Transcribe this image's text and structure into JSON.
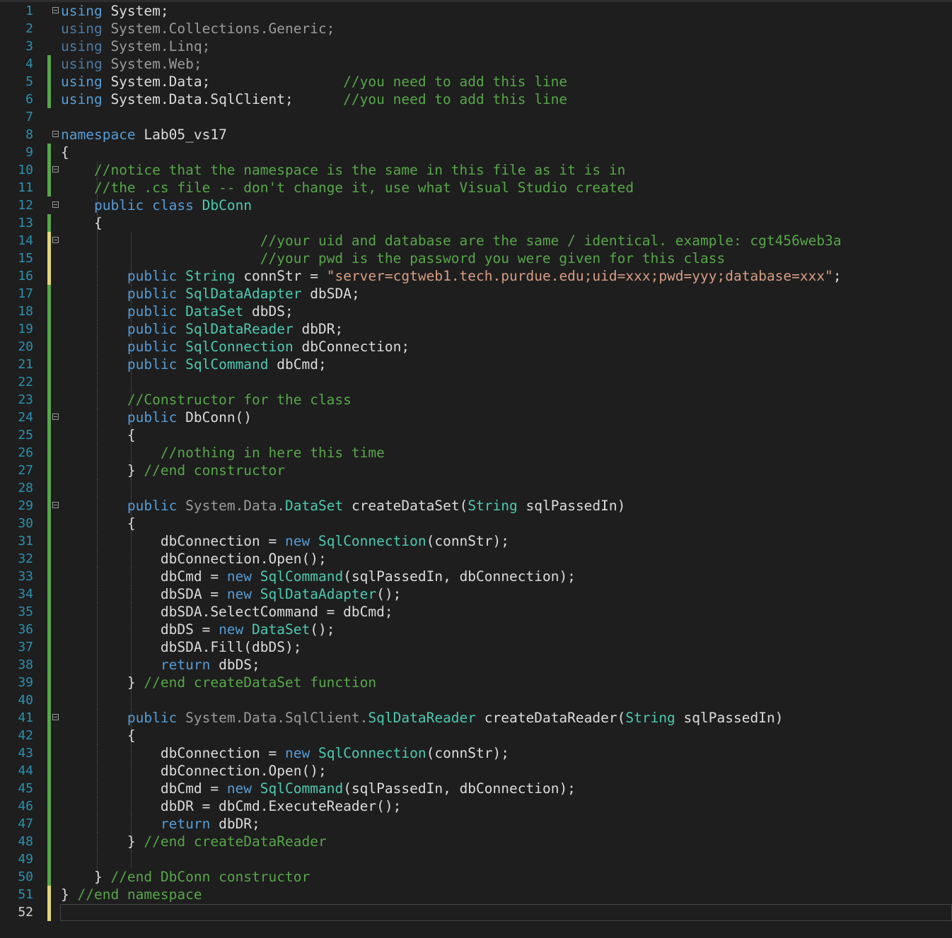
{
  "lines": [
    {
      "n": "1",
      "bar": "none",
      "fold": true,
      "segs": [
        [
          "kw",
          "using"
        ],
        [
          "txt",
          " System;"
        ]
      ]
    },
    {
      "n": "2",
      "bar": "none",
      "fold": false,
      "segs": [
        [
          "dimkw",
          "using"
        ],
        [
          "dim",
          " System.Collections.Generic;"
        ]
      ]
    },
    {
      "n": "3",
      "bar": "none",
      "fold": false,
      "segs": [
        [
          "dimkw",
          "using"
        ],
        [
          "dim",
          " System.Linq;"
        ]
      ]
    },
    {
      "n": "4",
      "bar": "green",
      "fold": false,
      "segs": [
        [
          "dimkw",
          "using"
        ],
        [
          "dim",
          " System.Web;"
        ]
      ]
    },
    {
      "n": "5",
      "bar": "green",
      "fold": false,
      "segs": [
        [
          "kw",
          "using"
        ],
        [
          "txt",
          " System.Data;                "
        ],
        [
          "cmt",
          "//you need to add this line"
        ]
      ]
    },
    {
      "n": "6",
      "bar": "green",
      "fold": false,
      "segs": [
        [
          "kw",
          "using"
        ],
        [
          "txt",
          " System.Data.SqlClient;      "
        ],
        [
          "cmt",
          "//you need to add this line"
        ]
      ]
    },
    {
      "n": "7",
      "bar": "none",
      "fold": false,
      "segs": []
    },
    {
      "n": "8",
      "bar": "none",
      "fold": true,
      "segs": [
        [
          "kw",
          "namespace"
        ],
        [
          "txt",
          " Lab05_vs17"
        ]
      ]
    },
    {
      "n": "9",
      "bar": "green",
      "fold": false,
      "segs": [
        [
          "txt",
          "{"
        ]
      ]
    },
    {
      "n": "10",
      "bar": "green",
      "fold": true,
      "segs": [
        [
          "txt",
          "    "
        ],
        [
          "cmt",
          "//notice that the namespace is the same in this file as it is in"
        ]
      ]
    },
    {
      "n": "11",
      "bar": "green",
      "fold": false,
      "segs": [
        [
          "txt",
          "    "
        ],
        [
          "cmt",
          "//the .cs file -- don't change it, use what Visual Studio created"
        ]
      ]
    },
    {
      "n": "12",
      "bar": "none",
      "fold": true,
      "segs": [
        [
          "txt",
          "    "
        ],
        [
          "kw",
          "public"
        ],
        [
          "txt",
          " "
        ],
        [
          "kw",
          "class"
        ],
        [
          "txt",
          " "
        ],
        [
          "type",
          "DbConn"
        ]
      ]
    },
    {
      "n": "13",
      "bar": "green",
      "fold": false,
      "segs": [
        [
          "txt",
          "    {"
        ]
      ]
    },
    {
      "n": "14",
      "bar": "yellow",
      "fold": true,
      "segs": [
        [
          "txt",
          "                        "
        ],
        [
          "cmt",
          "//your uid and database are the same / identical. example: cgt456web3a"
        ]
      ]
    },
    {
      "n": "15",
      "bar": "yellow",
      "fold": false,
      "segs": [
        [
          "txt",
          "                        "
        ],
        [
          "cmt",
          "//your pwd is the password you were given for this class"
        ]
      ]
    },
    {
      "n": "16",
      "bar": "yellow",
      "fold": false,
      "segs": [
        [
          "txt",
          "        "
        ],
        [
          "kw",
          "public"
        ],
        [
          "txt",
          " "
        ],
        [
          "type",
          "String"
        ],
        [
          "txt",
          " connStr = "
        ],
        [
          "str",
          "\"server=cgtweb1.tech.purdue.edu;uid=xxx;pwd=yyy;database=xxx\""
        ],
        [
          "txt",
          ";"
        ]
      ]
    },
    {
      "n": "17",
      "bar": "green",
      "fold": false,
      "segs": [
        [
          "txt",
          "        "
        ],
        [
          "kw",
          "public"
        ],
        [
          "txt",
          " "
        ],
        [
          "type",
          "SqlDataAdapter"
        ],
        [
          "txt",
          " dbSDA;"
        ]
      ]
    },
    {
      "n": "18",
      "bar": "green",
      "fold": false,
      "segs": [
        [
          "txt",
          "        "
        ],
        [
          "kw",
          "public"
        ],
        [
          "txt",
          " "
        ],
        [
          "type",
          "DataSet"
        ],
        [
          "txt",
          " dbDS;"
        ]
      ]
    },
    {
      "n": "19",
      "bar": "green",
      "fold": false,
      "segs": [
        [
          "txt",
          "        "
        ],
        [
          "kw",
          "public"
        ],
        [
          "txt",
          " "
        ],
        [
          "type",
          "SqlDataReader"
        ],
        [
          "txt",
          " dbDR;"
        ]
      ]
    },
    {
      "n": "20",
      "bar": "green",
      "fold": false,
      "segs": [
        [
          "txt",
          "        "
        ],
        [
          "kw",
          "public"
        ],
        [
          "txt",
          " "
        ],
        [
          "type",
          "SqlConnection"
        ],
        [
          "txt",
          " dbConnection;"
        ]
      ]
    },
    {
      "n": "21",
      "bar": "green",
      "fold": false,
      "segs": [
        [
          "txt",
          "        "
        ],
        [
          "kw",
          "public"
        ],
        [
          "txt",
          " "
        ],
        [
          "type",
          "SqlCommand"
        ],
        [
          "txt",
          " dbCmd;"
        ]
      ]
    },
    {
      "n": "22",
      "bar": "green",
      "fold": false,
      "segs": []
    },
    {
      "n": "23",
      "bar": "green",
      "fold": false,
      "segs": [
        [
          "txt",
          "        "
        ],
        [
          "cmt",
          "//Constructor for the class"
        ]
      ]
    },
    {
      "n": "24",
      "bar": "green",
      "fold": true,
      "segs": [
        [
          "txt",
          "        "
        ],
        [
          "kw",
          "public"
        ],
        [
          "txt",
          " DbConn()"
        ]
      ]
    },
    {
      "n": "25",
      "bar": "green",
      "fold": false,
      "segs": [
        [
          "txt",
          "        {"
        ]
      ]
    },
    {
      "n": "26",
      "bar": "green",
      "fold": false,
      "segs": [
        [
          "txt",
          "            "
        ],
        [
          "cmt",
          "//nothing in here this time"
        ]
      ]
    },
    {
      "n": "27",
      "bar": "green",
      "fold": false,
      "segs": [
        [
          "txt",
          "        } "
        ],
        [
          "cmt",
          "//end constructor"
        ]
      ]
    },
    {
      "n": "28",
      "bar": "green",
      "fold": false,
      "segs": []
    },
    {
      "n": "29",
      "bar": "green",
      "fold": true,
      "segs": [
        [
          "txt",
          "        "
        ],
        [
          "kw",
          "public"
        ],
        [
          "txt",
          " "
        ],
        [
          "dim",
          "System.Data."
        ],
        [
          "type",
          "DataSet"
        ],
        [
          "txt",
          " createDataSet("
        ],
        [
          "type",
          "String"
        ],
        [
          "txt",
          " sqlPassedIn)"
        ]
      ]
    },
    {
      "n": "30",
      "bar": "green",
      "fold": false,
      "segs": [
        [
          "txt",
          "        {"
        ]
      ]
    },
    {
      "n": "31",
      "bar": "green",
      "fold": false,
      "segs": [
        [
          "txt",
          "            dbConnection = "
        ],
        [
          "kw",
          "new"
        ],
        [
          "txt",
          " "
        ],
        [
          "type",
          "SqlConnection"
        ],
        [
          "txt",
          "(connStr);"
        ]
      ]
    },
    {
      "n": "32",
      "bar": "green",
      "fold": false,
      "segs": [
        [
          "txt",
          "            dbConnection.Open();"
        ]
      ]
    },
    {
      "n": "33",
      "bar": "green",
      "fold": false,
      "segs": [
        [
          "txt",
          "            dbCmd = "
        ],
        [
          "kw",
          "new"
        ],
        [
          "txt",
          " "
        ],
        [
          "type",
          "SqlCommand"
        ],
        [
          "txt",
          "(sqlPassedIn, dbConnection);"
        ]
      ]
    },
    {
      "n": "34",
      "bar": "green",
      "fold": false,
      "segs": [
        [
          "txt",
          "            dbSDA = "
        ],
        [
          "kw",
          "new"
        ],
        [
          "txt",
          " "
        ],
        [
          "type",
          "SqlDataAdapter"
        ],
        [
          "txt",
          "();"
        ]
      ]
    },
    {
      "n": "35",
      "bar": "green",
      "fold": false,
      "segs": [
        [
          "txt",
          "            dbSDA.SelectCommand = dbCmd;"
        ]
      ]
    },
    {
      "n": "36",
      "bar": "green",
      "fold": false,
      "segs": [
        [
          "txt",
          "            dbDS = "
        ],
        [
          "kw",
          "new"
        ],
        [
          "txt",
          " "
        ],
        [
          "type",
          "DataSet"
        ],
        [
          "txt",
          "();"
        ]
      ]
    },
    {
      "n": "37",
      "bar": "green",
      "fold": false,
      "segs": [
        [
          "txt",
          "            dbSDA.Fill(dbDS);"
        ]
      ]
    },
    {
      "n": "38",
      "bar": "green",
      "fold": false,
      "segs": [
        [
          "txt",
          "            "
        ],
        [
          "kw",
          "return"
        ],
        [
          "txt",
          " dbDS;"
        ]
      ]
    },
    {
      "n": "39",
      "bar": "green",
      "fold": false,
      "segs": [
        [
          "txt",
          "        } "
        ],
        [
          "cmt",
          "//end createDataSet function"
        ]
      ]
    },
    {
      "n": "40",
      "bar": "green",
      "fold": false,
      "segs": []
    },
    {
      "n": "41",
      "bar": "green",
      "fold": true,
      "segs": [
        [
          "txt",
          "        "
        ],
        [
          "kw",
          "public"
        ],
        [
          "txt",
          " "
        ],
        [
          "dim",
          "System.Data.SqlClient."
        ],
        [
          "type",
          "SqlDataReader"
        ],
        [
          "txt",
          " createDataReader("
        ],
        [
          "type",
          "String"
        ],
        [
          "txt",
          " sqlPassedIn)"
        ]
      ]
    },
    {
      "n": "42",
      "bar": "green",
      "fold": false,
      "segs": [
        [
          "txt",
          "        {"
        ]
      ]
    },
    {
      "n": "43",
      "bar": "green",
      "fold": false,
      "segs": [
        [
          "txt",
          "            dbConnection = "
        ],
        [
          "kw",
          "new"
        ],
        [
          "txt",
          " "
        ],
        [
          "type",
          "SqlConnection"
        ],
        [
          "txt",
          "(connStr);"
        ]
      ]
    },
    {
      "n": "44",
      "bar": "green",
      "fold": false,
      "segs": [
        [
          "txt",
          "            dbConnection.Open();"
        ]
      ]
    },
    {
      "n": "45",
      "bar": "green",
      "fold": false,
      "segs": [
        [
          "txt",
          "            dbCmd = "
        ],
        [
          "kw",
          "new"
        ],
        [
          "txt",
          " "
        ],
        [
          "type",
          "SqlCommand"
        ],
        [
          "txt",
          "(sqlPassedIn, dbConnection);"
        ]
      ]
    },
    {
      "n": "46",
      "bar": "green",
      "fold": false,
      "segs": [
        [
          "txt",
          "            dbDR = dbCmd.ExecuteReader();"
        ]
      ]
    },
    {
      "n": "47",
      "bar": "green",
      "fold": false,
      "segs": [
        [
          "txt",
          "            "
        ],
        [
          "kw",
          "return"
        ],
        [
          "txt",
          " dbDR;"
        ]
      ]
    },
    {
      "n": "48",
      "bar": "green",
      "fold": false,
      "segs": [
        [
          "txt",
          "        } "
        ],
        [
          "cmt",
          "//end createDataReader"
        ]
      ]
    },
    {
      "n": "49",
      "bar": "green",
      "fold": false,
      "segs": []
    },
    {
      "n": "50",
      "bar": "green",
      "fold": false,
      "segs": [
        [
          "txt",
          "    } "
        ],
        [
          "cmt",
          "//end DbConn constructor"
        ]
      ]
    },
    {
      "n": "51",
      "bar": "yellow",
      "fold": false,
      "segs": [
        [
          "txt",
          "} "
        ],
        [
          "cmt",
          "//end namespace"
        ]
      ]
    },
    {
      "n": "52",
      "bar": "yellow",
      "fold": false,
      "segs": [],
      "current": true
    }
  ],
  "colors": {
    "background": "#1e1e1e",
    "keyword": "#569cd6",
    "type": "#4ec9b0",
    "comment": "#57a64a",
    "string": "#d69d85",
    "line_number": "#2b91af",
    "change_saved": "#57a64a",
    "change_unsaved": "#e2d775"
  }
}
